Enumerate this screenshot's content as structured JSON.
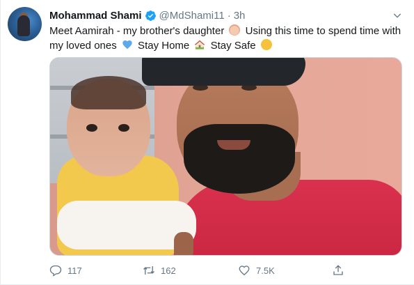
{
  "tweet": {
    "author_name": "Mohammad Shami",
    "handle": "@MdShami11",
    "separator": "·",
    "time": "3h",
    "text_1": "Meet Aamirah - my brother's daughter",
    "text_2": " Using this time to spend time with my loved ones",
    "text_3": " Stay Home",
    "text_4": " Stay Safe",
    "emojis": [
      "baby-emoji",
      "blue-heart-emoji",
      "house-with-garden-emoji",
      "hugging-face-emoji"
    ]
  },
  "actions": {
    "replies": "117",
    "retweets": "162",
    "likes": "7.5K"
  },
  "colors": {
    "verified": "#1da1f2",
    "muted": "#657786",
    "text": "#14171a",
    "heart": "#5da9e9"
  },
  "icons": {
    "verified": "verified-badge-icon",
    "caret": "chevron-down-icon",
    "reply": "reply-icon",
    "retweet": "retweet-icon",
    "like": "heart-icon",
    "share": "share-icon"
  }
}
